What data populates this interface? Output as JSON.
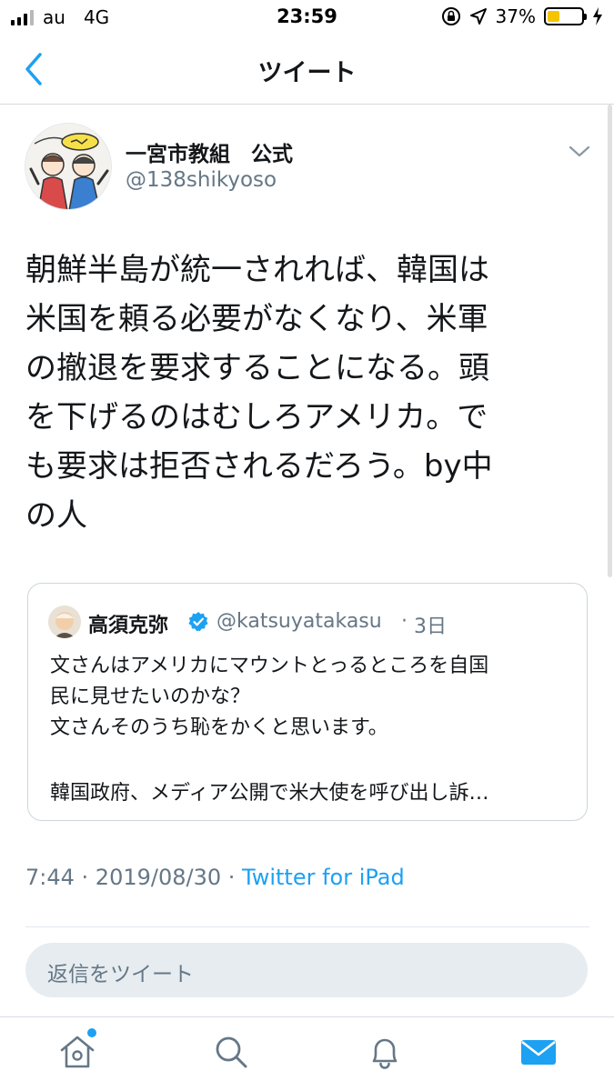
{
  "status_bar": {
    "carrier": "au",
    "network": "4G",
    "time": "23:59",
    "battery_percent": "37%",
    "battery_level": 0.37,
    "icons": [
      "signal-icon",
      "orientation-lock-icon",
      "location-arrow-icon",
      "battery-icon",
      "charging-bolt-icon"
    ]
  },
  "nav": {
    "title": "ツイート",
    "back_icon": "chevron-left-icon"
  },
  "tweet": {
    "display_name": "一宮市教組　公式",
    "handle": "@138shikyoso",
    "text": "朝鮮半島が統一されれば、韓国は\n米国を頼る必要がなくなり、米軍\nの撤退を要求することになる。頭\nを下げるのはむしろアメリカ。で\nも要求は拒否されるだろう。by中\nの人",
    "time": "7:44",
    "date": "2019/08/30",
    "source": "Twitter for iPad"
  },
  "quote": {
    "display_name": "高須克弥",
    "verified": true,
    "handle": "@katsuyatakasu",
    "separator": "·",
    "time_ago": "3日",
    "text": "文さんはアメリカにマウントとっるところを自国\n民に見せたいのかな？\n文さんそのうち恥をかくと思います。",
    "text_more": "韓国政府、メディア公開で米大使を呼び出し訴…"
  },
  "meta": {
    "separator": " · "
  },
  "reply": {
    "placeholder": "返信をツイート"
  },
  "tabs": [
    {
      "name": "home",
      "icon": "home-icon",
      "active": false,
      "has_badge": true
    },
    {
      "name": "search",
      "icon": "search-icon",
      "active": false
    },
    {
      "name": "notifications",
      "icon": "bell-icon",
      "active": false
    },
    {
      "name": "messages",
      "icon": "mail-icon",
      "active": true
    }
  ],
  "colors": {
    "accent": "#1da1f2",
    "text_primary": "#14171a",
    "text_secondary": "#657786",
    "border": "#ccd6dd",
    "reply_bg": "#e6ecf0",
    "battery_fill": "#f5c400"
  }
}
